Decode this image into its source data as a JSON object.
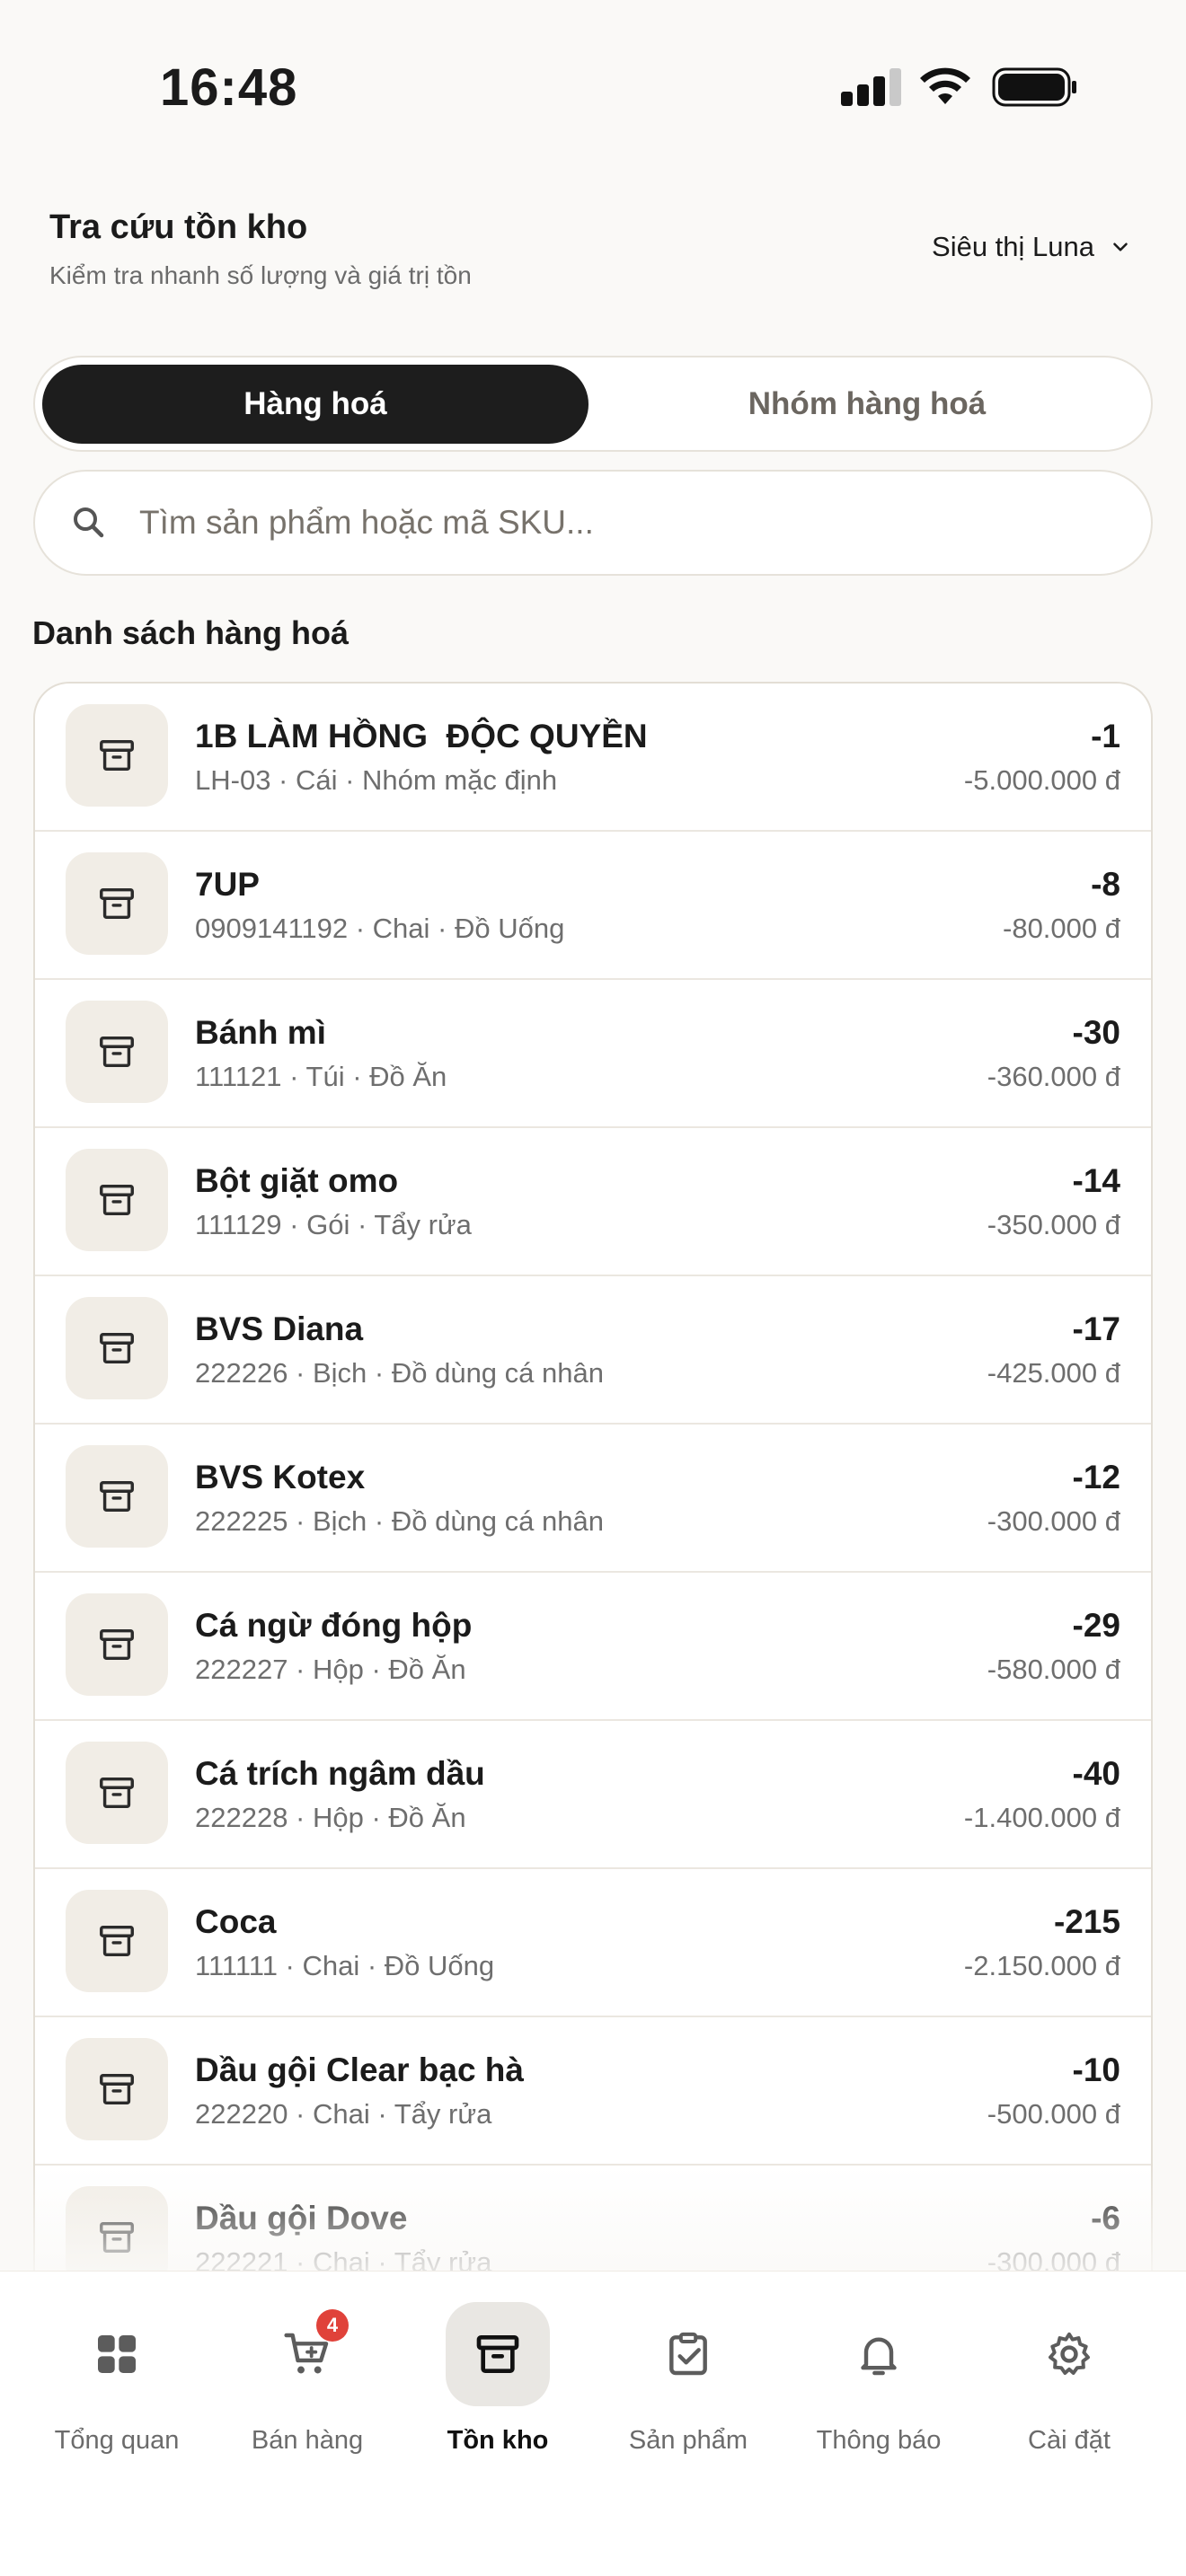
{
  "status": {
    "time": "16:48"
  },
  "header": {
    "title": "Tra cứu tồn kho",
    "subtitle": "Kiểm tra nhanh số lượng và giá trị tồn",
    "store": "Siêu thị Luna"
  },
  "segments": {
    "active": "Hàng hoá",
    "inactive": "Nhóm hàng hoá"
  },
  "search": {
    "placeholder": "Tìm sản phẩm hoặc mã SKU..."
  },
  "list": {
    "title": "Danh sách hàng hoá",
    "items": [
      {
        "name": "1B LÀM HỒNG  ĐỘC QUYỀN",
        "meta": "LH-03 · Cái · Nhóm mặc định",
        "qty": "-1",
        "value": "-5.000.000 đ"
      },
      {
        "name": "7UP",
        "meta": "0909141192 · Chai · Đồ Uống",
        "qty": "-8",
        "value": "-80.000 đ"
      },
      {
        "name": "Bánh mì",
        "meta": "111121 · Túi · Đồ Ăn",
        "qty": "-30",
        "value": "-360.000 đ"
      },
      {
        "name": "Bột giặt omo",
        "meta": "111129 · Gói · Tẩy rửa",
        "qty": "-14",
        "value": "-350.000 đ"
      },
      {
        "name": "BVS Diana",
        "meta": "222226 · Bịch · Đồ dùng cá nhân",
        "qty": "-17",
        "value": "-425.000 đ"
      },
      {
        "name": "BVS Kotex",
        "meta": "222225 · Bịch · Đồ dùng cá nhân",
        "qty": "-12",
        "value": "-300.000 đ"
      },
      {
        "name": "Cá ngừ đóng hộp",
        "meta": "222227 · Hộp · Đồ Ăn",
        "qty": "-29",
        "value": "-580.000 đ"
      },
      {
        "name": "Cá trích ngâm dầu",
        "meta": "222228 · Hộp · Đồ Ăn",
        "qty": "-40",
        "value": "-1.400.000 đ"
      },
      {
        "name": "Coca",
        "meta": "111111 · Chai · Đồ Uống",
        "qty": "-215",
        "value": "-2.150.000 đ"
      },
      {
        "name": "Dầu gội Clear bạc hà",
        "meta": "222220 · Chai · Tẩy rửa",
        "qty": "-10",
        "value": "-500.000 đ"
      },
      {
        "name": "Dầu gội Dove",
        "meta": "222221 · Chai · Tẩy rửa",
        "qty": "-6",
        "value": "-300.000 đ"
      }
    ]
  },
  "tabbar": {
    "tabs": [
      {
        "label": "Tổng quan",
        "icon": "grid-icon"
      },
      {
        "label": "Bán hàng",
        "icon": "cart-icon",
        "badge": "4"
      },
      {
        "label": "Tồn kho",
        "icon": "archive-icon",
        "active": true
      },
      {
        "label": "Sản phẩm",
        "icon": "clipboard-check-icon"
      },
      {
        "label": "Thông báo",
        "icon": "bell-icon"
      },
      {
        "label": "Cài đặt",
        "icon": "gear-icon"
      }
    ]
  },
  "colors": {
    "active_segment": "#1d1d1d",
    "badge": "#e0423a",
    "item_icon_bg": "#f1ede6"
  }
}
